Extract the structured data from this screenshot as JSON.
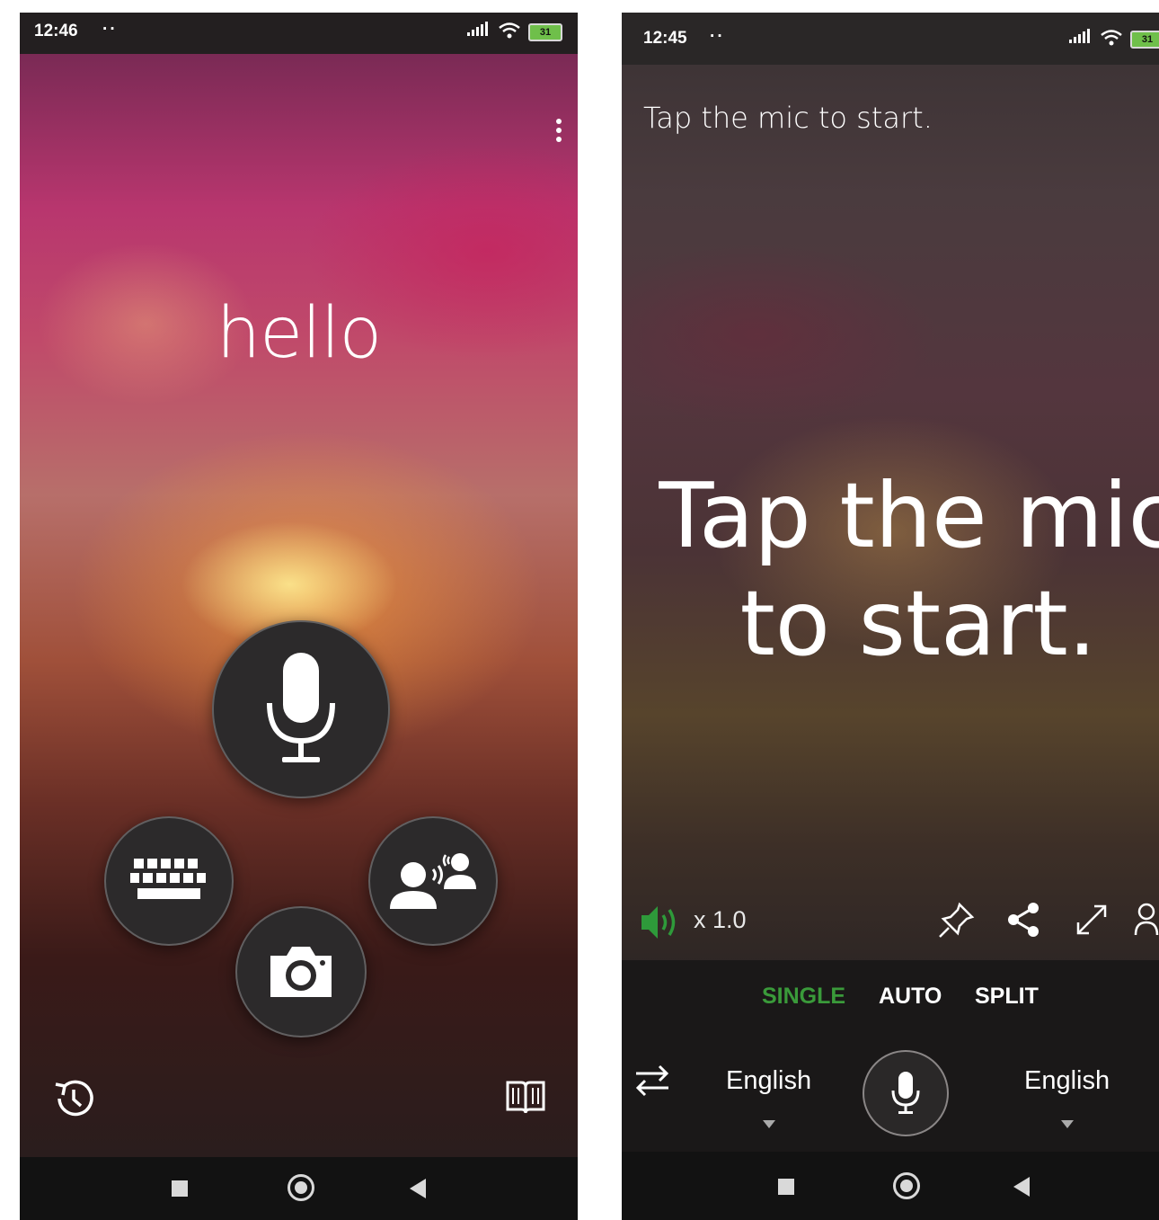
{
  "left_screen": {
    "status": {
      "time": "12:46",
      "dots": "··",
      "battery": "31"
    },
    "display_text": "hello",
    "icons": {
      "more": "more-vert-icon",
      "mic": "microphone-icon",
      "keyboard": "keyboard-icon",
      "camera": "camera-icon",
      "conversation": "conversation-icon",
      "history": "history-icon",
      "phrasebook": "book-icon"
    }
  },
  "right_screen": {
    "status": {
      "time": "12:45",
      "dots": "··",
      "battery": "31"
    },
    "prompt_small": "Tap the mic to start.",
    "prompt_big_line1": "Tap the mic",
    "prompt_big_line2": "to start.",
    "speed": "x 1.0",
    "modes": {
      "single": "SINGLE",
      "auto": "AUTO",
      "split": "SPLIT"
    },
    "active_mode_color": "#3a9a3a",
    "source_language": "English",
    "target_language": "English",
    "icons": {
      "speaker": "speaker-icon",
      "pin": "pin-icon",
      "share": "share-icon",
      "expand": "expand-icon",
      "person": "person-add-icon",
      "swap": "swap-icon",
      "mic": "microphone-icon"
    }
  }
}
